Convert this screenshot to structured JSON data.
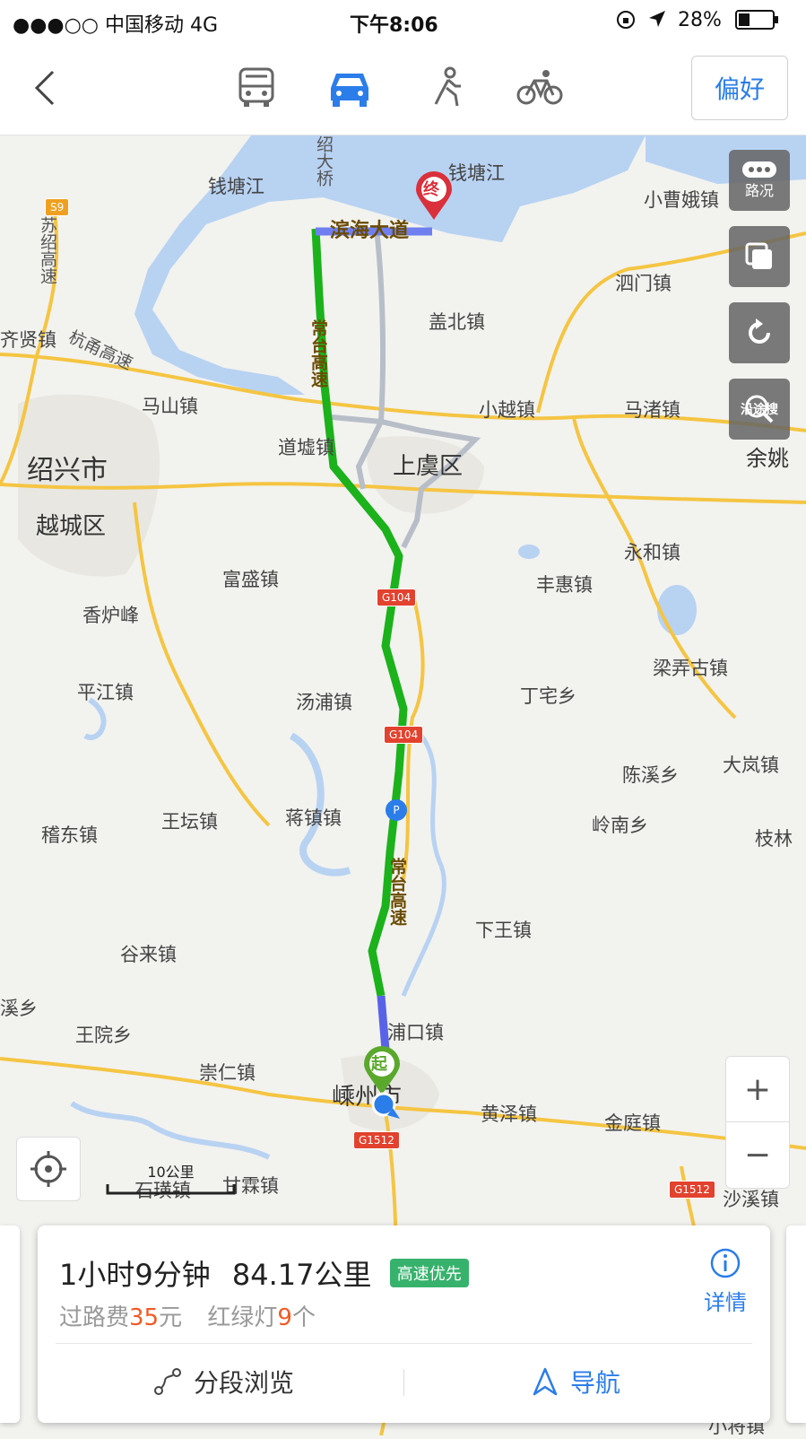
{
  "status_bar": {
    "carrier": "●●●○○ 中国移动  4G",
    "time": "下午8:06",
    "battery": "28%"
  },
  "nav_bar": {
    "modes": [
      {
        "name": "bus",
        "icon": "bus-icon"
      },
      {
        "name": "car",
        "icon": "car-icon",
        "selected": true
      },
      {
        "name": "walk",
        "icon": "walk-icon"
      },
      {
        "name": "bike",
        "icon": "bike-icon"
      }
    ],
    "preference_label": "偏好",
    "accent_color": "#2b7de9"
  },
  "map": {
    "places": {
      "qiantangjiang_w": "钱塘江",
      "qiantangjiang_e": "钱塘江",
      "xiaocao_e": "小曹娥镇",
      "simen": "泗门镇",
      "gaibei": "盖北镇",
      "jixian": "齐贤镇",
      "mashan": "马山镇",
      "xiaoyue": "小越镇",
      "mazhu": "马渚镇",
      "yuyao": "余姚",
      "shaoxing": "绍兴市",
      "daoxu": "道墟镇",
      "shangyu": "上虞区",
      "yuecheng": "越城区",
      "fusheng": "富盛镇",
      "xianglufeng": "香炉峰",
      "yonghe": "永和镇",
      "fenghui": "丰惠镇",
      "liangnong": "梁弄古镇",
      "pingjiang": "平江镇",
      "tangpu": "汤浦镇",
      "dingzhai": "丁宅乡",
      "chenxi": "陈溪乡",
      "dalan": "大岚镇",
      "jidong": "稽东镇",
      "wangtan": "王坛镇",
      "jiangzhen": "蒋镇镇",
      "lingnan": "岭南乡",
      "zhilin": "枝林",
      "xiawang": "下王镇",
      "gulai": "谷来镇",
      "xixiang": "溪乡",
      "wangyuan": "王院乡",
      "pukou": "浦口镇",
      "chongren": "崇仁镇",
      "shengzhou": "嵊州市",
      "huangze": "黄泽镇",
      "jinting": "金庭镇",
      "shihuang": "石璜镇",
      "ganlin": "甘霖镇",
      "shaxi": "沙溪镇",
      "xiaojiang": "小将镇"
    },
    "roads": {
      "shaoda": "绍大桥",
      "binhai": "滨海大道",
      "changtai_n": "常台高速",
      "changtai_s": "常台高速",
      "hangyong": "杭甬高速",
      "sushao": "苏绍高速"
    },
    "shields": {
      "s9": "S9",
      "g104_a": "G104",
      "g104_b": "G104",
      "g1512_a": "G1512",
      "g1512_b": "G1512"
    },
    "markers": {
      "start": "起",
      "end": "终"
    },
    "controls": {
      "traffic_label": "路况",
      "along_search_label": "沿途搜"
    },
    "scale_label": "10公里",
    "route_color": "#1bb21b"
  },
  "route_card": {
    "duration": "1小时9分钟",
    "distance": "84.17公里",
    "tag": "高速优先",
    "toll_prefix": "过路费",
    "toll_value": "35",
    "toll_unit": "元",
    "lights_prefix": "红绿灯",
    "lights_value": "9",
    "lights_unit": "个",
    "detail_label": "详情",
    "segment_label": "分段浏览",
    "navigate_label": "导航"
  }
}
